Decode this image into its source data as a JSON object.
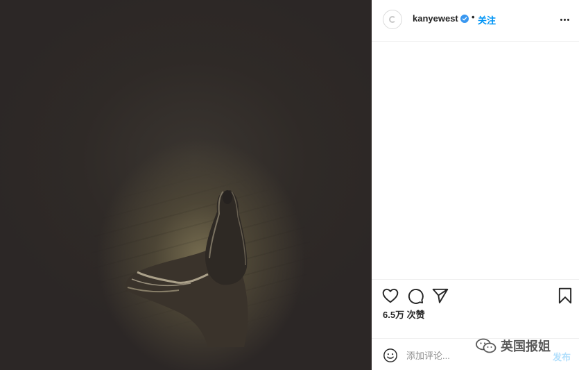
{
  "post": {
    "image": {
      "alt": ""
    },
    "header": {
      "username": "kanyewest",
      "separator": "•",
      "follow_label": "关注"
    },
    "likes_text": "6.5万 次赞",
    "comment": {
      "placeholder": "添加评论...",
      "post_label": "发布"
    }
  },
  "icons": {
    "like": "heart-icon",
    "comment": "comment-bubble-icon",
    "share": "paper-plane-icon",
    "save": "bookmark-icon",
    "emoji": "smiley-icon",
    "more": "more-options-icon",
    "verified": "verified-badge-icon"
  },
  "colors": {
    "link_blue": "#0095f6",
    "verified_blue": "#3897f0",
    "text": "#262626",
    "muted": "#8e8e8e",
    "divider": "#efefef"
  },
  "watermark": {
    "text": "英国报姐"
  }
}
